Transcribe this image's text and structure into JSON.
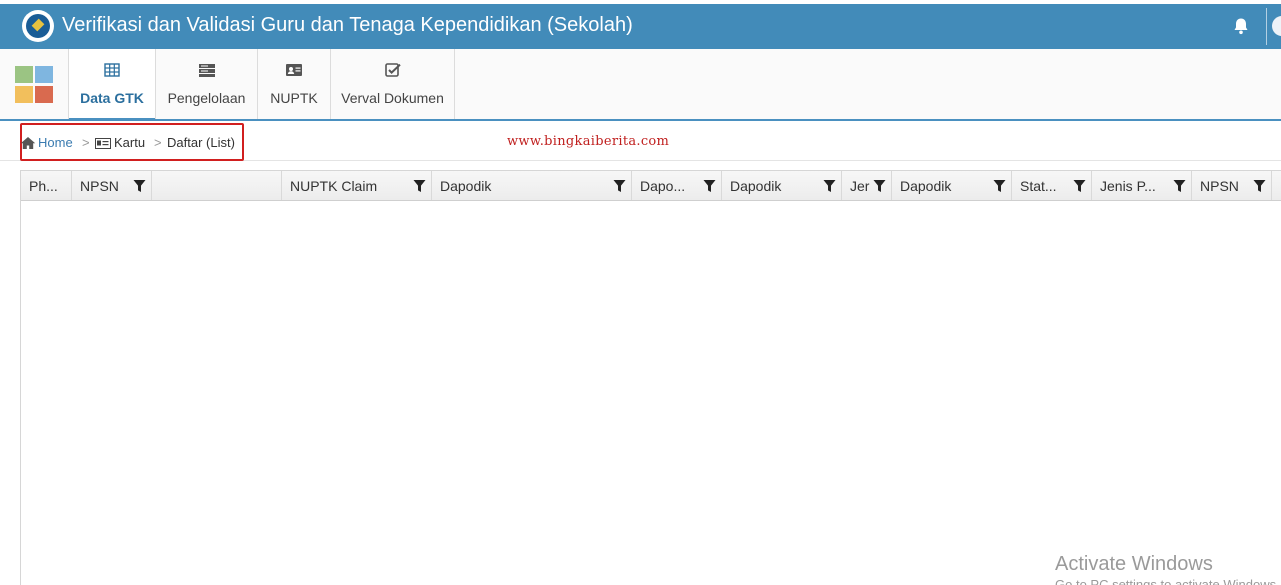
{
  "header": {
    "title": "Verifikasi dan Validasi Guru dan Tenaga Kependidikan (Sekolah)",
    "logo_icon": "tut-wuri-handayani-logo",
    "notification_icon": "bell-icon",
    "bg_color": "#428bb9"
  },
  "ribbon": {
    "apps_icon": "app-grid-icon",
    "apps_colors": [
      "#9bc483",
      "#7fb6e0",
      "#f2bf5c",
      "#d96a4f"
    ],
    "tabs": [
      {
        "label": "Data GTK",
        "icon": "table-icon",
        "active": true
      },
      {
        "label": "Pengelolaan",
        "icon": "server-icon",
        "active": false
      },
      {
        "label": "NUPTK",
        "icon": "id-card-icon",
        "active": false
      },
      {
        "label": "Verval Dokumen",
        "icon": "check-square-icon",
        "active": false
      }
    ]
  },
  "breadcrumb": {
    "home": "Home",
    "mid": "Kartu",
    "current": "Daftar (List)",
    "separator": ">"
  },
  "watermark": "www.bingkaiberita.com",
  "grid": {
    "columns": [
      {
        "label": "Ph...",
        "filter": false
      },
      {
        "label": "NPSN",
        "filter": true
      },
      {
        "label": "",
        "filter": false
      },
      {
        "label": "NUPTK Claim",
        "filter": true
      },
      {
        "label": "Dapodik",
        "filter": true
      },
      {
        "label": "Dapo...",
        "filter": true
      },
      {
        "label": "Dapodik",
        "filter": true
      },
      {
        "label": "Jer",
        "filter": true
      },
      {
        "label": "Dapodik",
        "filter": true
      },
      {
        "label": "Stat...",
        "filter": true
      },
      {
        "label": "Jenis P...",
        "filter": true
      },
      {
        "label": "NPSN",
        "filter": true
      }
    ],
    "rows": []
  },
  "os_overlay": {
    "title": "Activate Windows",
    "subtitle": "Go to PC settings to activate Windows."
  }
}
